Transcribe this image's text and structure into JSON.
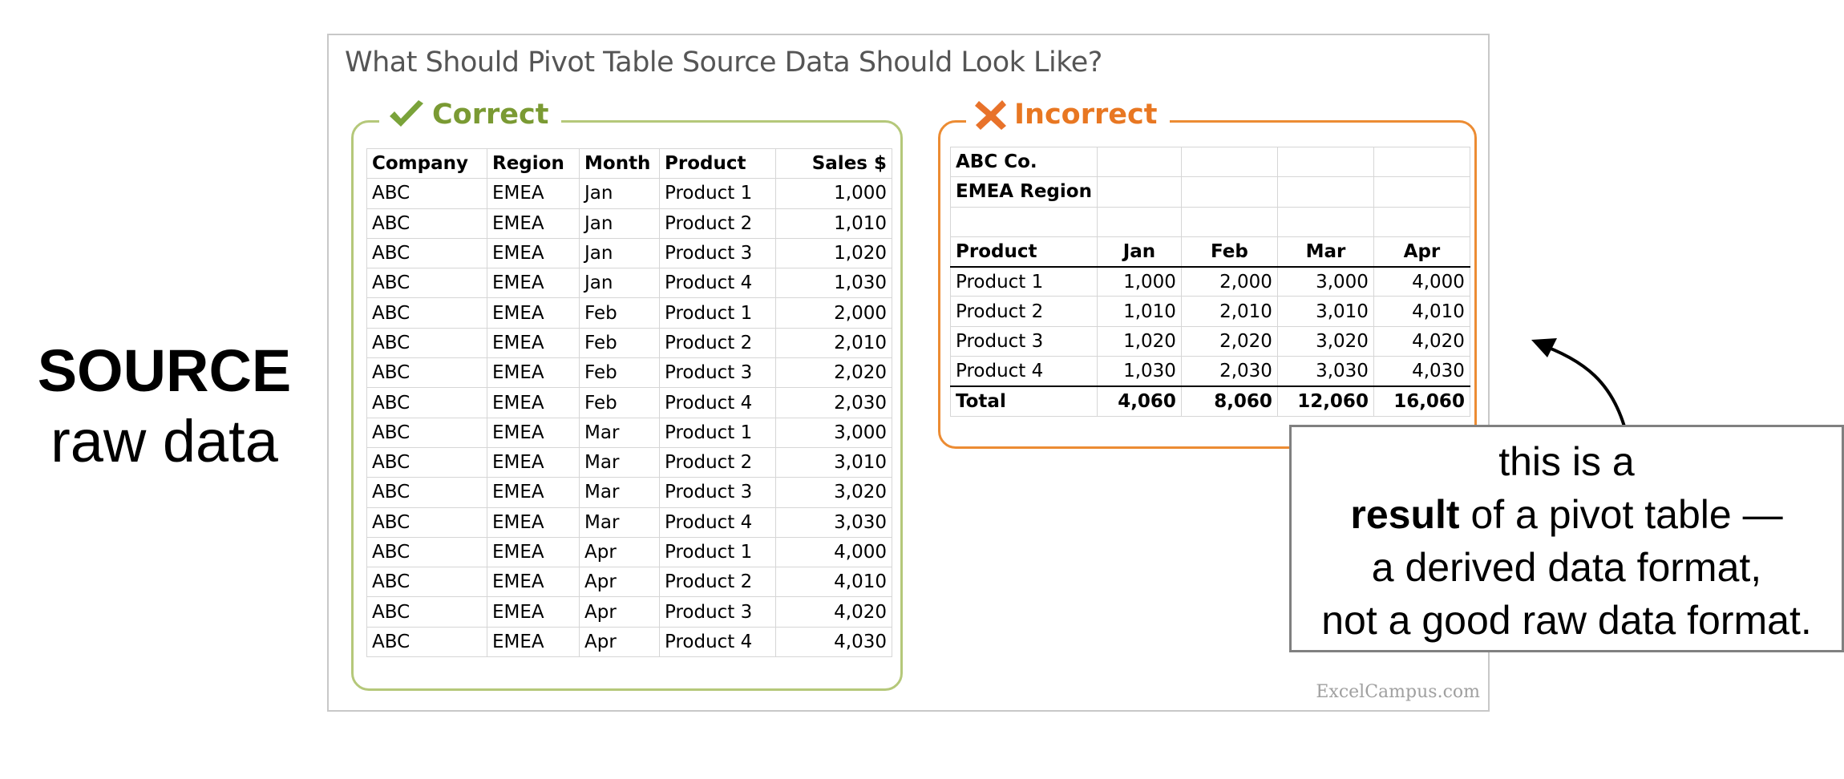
{
  "left_label": {
    "title": "SOURCE",
    "subtitle": "raw data"
  },
  "card": {
    "title": "What Should Pivot Table Source Data Should Look Like?",
    "watermark": "ExcelCampus.com"
  },
  "correct": {
    "label": "Correct",
    "icon": "checkmark-icon",
    "color": "#7a9a33",
    "headers": [
      "Company",
      "Region",
      "Month",
      "Product",
      "Sales $"
    ],
    "rows": [
      [
        "ABC",
        "EMEA",
        "Jan",
        "Product 1",
        "1,000"
      ],
      [
        "ABC",
        "EMEA",
        "Jan",
        "Product 2",
        "1,010"
      ],
      [
        "ABC",
        "EMEA",
        "Jan",
        "Product 3",
        "1,020"
      ],
      [
        "ABC",
        "EMEA",
        "Jan",
        "Product 4",
        "1,030"
      ],
      [
        "ABC",
        "EMEA",
        "Feb",
        "Product 1",
        "2,000"
      ],
      [
        "ABC",
        "EMEA",
        "Feb",
        "Product 2",
        "2,010"
      ],
      [
        "ABC",
        "EMEA",
        "Feb",
        "Product 3",
        "2,020"
      ],
      [
        "ABC",
        "EMEA",
        "Feb",
        "Product 4",
        "2,030"
      ],
      [
        "ABC",
        "EMEA",
        "Mar",
        "Product 1",
        "3,000"
      ],
      [
        "ABC",
        "EMEA",
        "Mar",
        "Product 2",
        "3,010"
      ],
      [
        "ABC",
        "EMEA",
        "Mar",
        "Product 3",
        "3,020"
      ],
      [
        "ABC",
        "EMEA",
        "Mar",
        "Product 4",
        "3,030"
      ],
      [
        "ABC",
        "EMEA",
        "Apr",
        "Product 1",
        "4,000"
      ],
      [
        "ABC",
        "EMEA",
        "Apr",
        "Product 2",
        "4,010"
      ],
      [
        "ABC",
        "EMEA",
        "Apr",
        "Product 3",
        "4,020"
      ],
      [
        "ABC",
        "EMEA",
        "Apr",
        "Product 4",
        "4,030"
      ]
    ]
  },
  "incorrect": {
    "label": "Incorrect",
    "icon": "x-mark-icon",
    "color": "#e87722",
    "company": "ABC Co.",
    "region": "EMEA Region",
    "headers": [
      "Product",
      "Jan",
      "Feb",
      "Mar",
      "Apr"
    ],
    "rows": [
      [
        "Product 1",
        "1,000",
        "2,000",
        "3,000",
        "4,000"
      ],
      [
        "Product 2",
        "1,010",
        "2,010",
        "3,010",
        "4,010"
      ],
      [
        "Product 3",
        "1,020",
        "2,020",
        "3,020",
        "4,020"
      ],
      [
        "Product 4",
        "1,030",
        "2,030",
        "3,030",
        "4,030"
      ]
    ],
    "total": [
      "Total",
      "4,060",
      "8,060",
      "12,060",
      "16,060"
    ]
  },
  "callout": {
    "line1": "this is a",
    "line2_bold": "result",
    "line2_rest": " of a pivot table —",
    "line3": "a derived data format,",
    "line4": "not a good raw data format."
  }
}
